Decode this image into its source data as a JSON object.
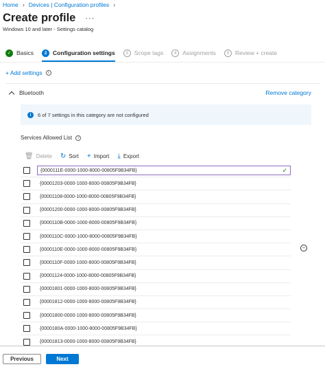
{
  "breadcrumb": [
    {
      "label": "Home"
    },
    {
      "label": "Devices | Configuration profiles"
    }
  ],
  "page": {
    "title": "Create profile",
    "more": "···",
    "subtitle": "Windows 10 and later - Settings catalog"
  },
  "steps": [
    {
      "num": "✓",
      "label": "Basics",
      "state": "done"
    },
    {
      "num": "2",
      "label": "Configuration settings",
      "state": "active"
    },
    {
      "num": "3",
      "label": "Scope tags",
      "state": "todo"
    },
    {
      "num": "4",
      "label": "Assignments",
      "state": "todo"
    },
    {
      "num": "5",
      "label": "Review + create",
      "state": "todo"
    }
  ],
  "add_settings": {
    "label": "+ Add settings"
  },
  "category": {
    "name": "Bluetooth",
    "remove_label": "Remove category",
    "banner": "6 of 7 settings in this category are not configured"
  },
  "list": {
    "title": "Services Allowed List",
    "toolbar": {
      "delete": "Delete",
      "sort": "Sort",
      "import": "Import",
      "export": "Export"
    },
    "rows": [
      "{0000111E-0000-1000-8000-00805F9B34FB}",
      "{00001203-0000-1000-8000-00805F9B34FB}",
      "{00001108-0000-1000-8000-00805F9B34FB}",
      "{00001200-0000-1000-8000-00805F9B34FB}",
      "{0000110B-0000-1000-8000-00805F9B34FB}",
      "{0000110C-0000-1000-8000-00805F9B34FB}",
      "{0000110E-0000-1000-8000-00805F9B34FB}",
      "{0000110F-0000-1000-8000-00805F9B34FB}",
      "{00001124-0000-1000-8000-00805F9B34FB}",
      "{00001801-0000-1000-8000-00805F9B34FB}",
      "{00001812-0000-1000-8000-00805F9B34FB}",
      "{00001800-0000-1000-8000-00805F9B34FB}",
      "{0000180A-0000-1000-8000-00805F9B34FB}",
      "{00001813-0000-1000-8000-00805F9B34FB}"
    ]
  },
  "footer": {
    "previous": "Previous",
    "next": "Next"
  },
  "colors": {
    "accent": "#0078d4",
    "success": "#107c10",
    "banner_bg": "#eff6fc",
    "edit_border": "#8a6bbf"
  }
}
